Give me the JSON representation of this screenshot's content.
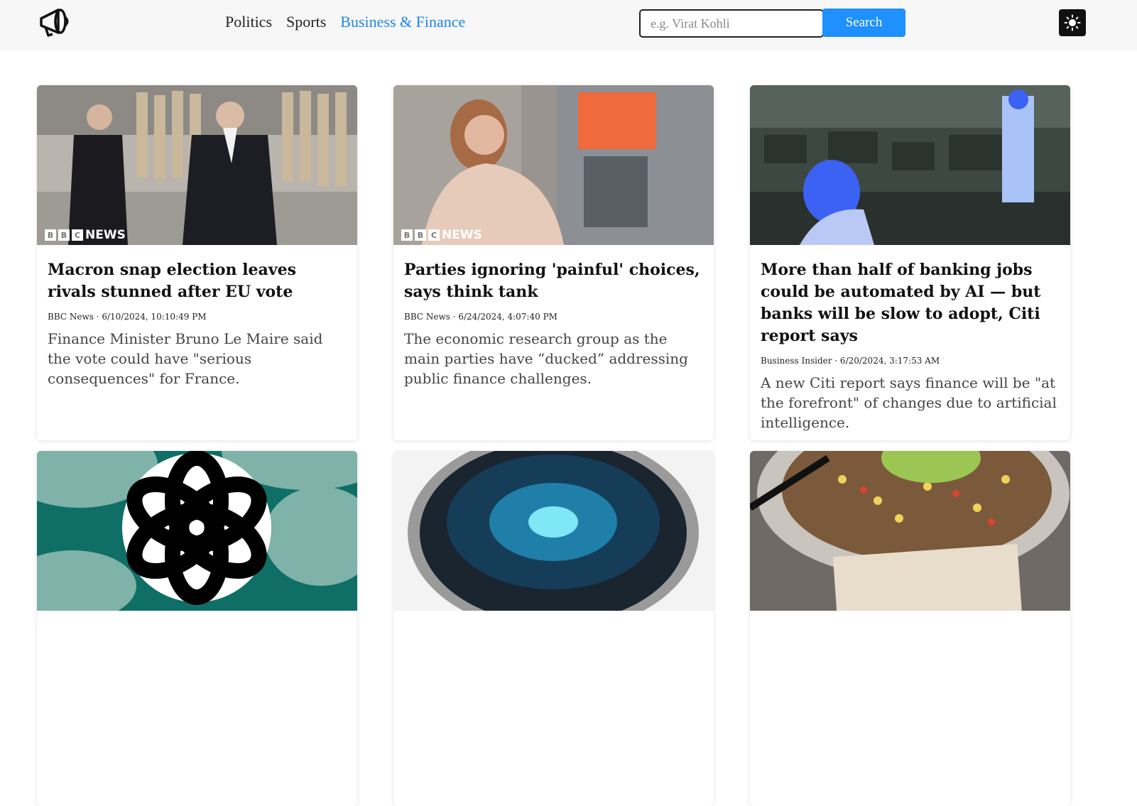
{
  "header": {
    "logo_icon": "megaphone-icon",
    "nav": [
      {
        "label": "Politics",
        "active": false
      },
      {
        "label": "Sports",
        "active": false
      },
      {
        "label": "Business & Finance",
        "active": true
      }
    ],
    "search": {
      "placeholder": "e.g. Virat Kohli",
      "value": "",
      "button_label": "Search"
    },
    "theme_toggle_icon": "sun-icon"
  },
  "articles": [
    {
      "title": "Macron snap election leaves rivals stunned after EU vote",
      "meta": "BBC News · 6/10/2024, 10:10:49 PM",
      "description": "Finance Minister Bruno Le Maire said the vote could have \"serious consequences\" for France.",
      "image_watermark": "NEWS"
    },
    {
      "title": "Parties ignoring 'painful' choices, says think tank",
      "meta": "BBC News · 6/24/2024, 4:07:40 PM",
      "description": "The economic research group as the main parties have “ducked” addressing public finance challenges.",
      "image_watermark": "NEWS"
    },
    {
      "title": "More than half of banking jobs could be automated by AI — but banks will be slow to adopt, Citi report says",
      "meta": "Business Insider · 6/20/2024, 3:17:53 AM",
      "description": "A new Citi report says finance will be \"at the forefront\" of changes due to artificial intelligence.",
      "image_watermark": ""
    },
    {
      "title": "",
      "meta": "",
      "description": "",
      "image_watermark": ""
    },
    {
      "title": "",
      "meta": "",
      "description": "",
      "image_watermark": ""
    },
    {
      "title": "",
      "meta": "",
      "description": "",
      "image_watermark": ""
    }
  ],
  "colors": {
    "accent": "#1e90ff",
    "active_nav": "#1e88e5",
    "header_bg": "#f7f7f7"
  }
}
